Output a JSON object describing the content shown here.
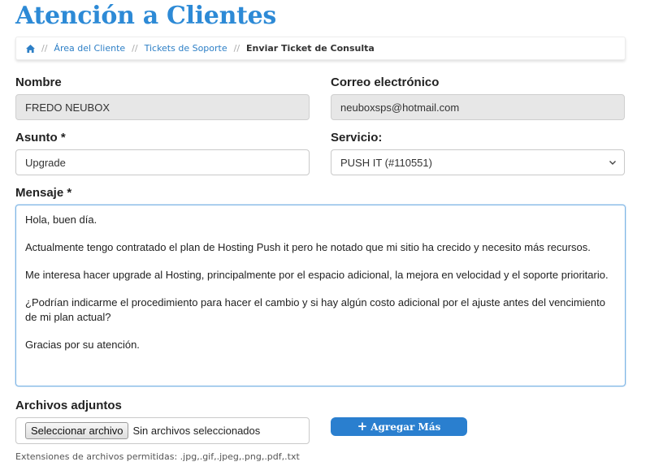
{
  "page": {
    "title": "Atención a Clientes"
  },
  "breadcrumb": {
    "home_icon": "home-icon",
    "items": [
      {
        "label": "Área del Cliente"
      },
      {
        "label": "Tickets de Soporte"
      },
      {
        "label": "Enviar Ticket de Consulta"
      }
    ],
    "separator": "//"
  },
  "form": {
    "name": {
      "label": "Nombre",
      "value": "FREDO NEUBOX"
    },
    "email": {
      "label": "Correo electrónico",
      "value": "neuboxsps@hotmail.com"
    },
    "subject": {
      "label": "Asunto *",
      "value": "Upgrade"
    },
    "service": {
      "label": "Servicio:",
      "selected": "PUSH IT (#110551)"
    },
    "message": {
      "label": "Mensaje *",
      "paragraphs": [
        "Hola, buen día.",
        "Actualmente tengo contratado el plan de Hosting Push it pero he notado que mi sitio ha crecido y necesito más recursos.",
        "Me interesa hacer upgrade al Hosting, principalmente por el espacio adicional, la mejora en velocidad y el soporte prioritario.",
        "¿Podrían indicarme el procedimiento para hacer el cambio y si hay algún costo adicional por el ajuste antes del vencimiento de mi plan actual?",
        "Gracias por su atención."
      ]
    },
    "attachments": {
      "label": "Archivos adjuntos",
      "choose_button": "Seleccionar archivo",
      "no_file_text": "Sin archivos seleccionados",
      "add_more_button": "Agregar Más",
      "allowed_extensions": "Extensiones de archivos permitidas: .jpg,.gif,.jpeg,.png,.pdf,.txt"
    }
  },
  "colors": {
    "title": "#2d8ad6",
    "link": "#2d7fc6",
    "button": "#2a7fcf"
  }
}
